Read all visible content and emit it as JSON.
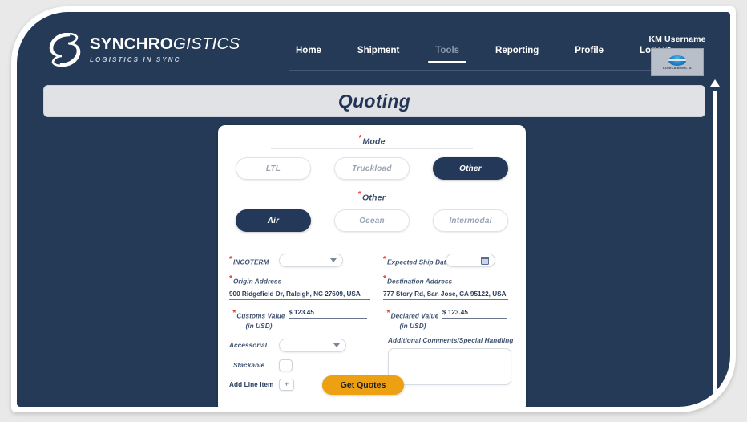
{
  "brand": {
    "name_strong": "SYNCHRO",
    "name_light": "GISTICS",
    "tagline": "LOGISTICS IN SYNC",
    "logo_icon": "synchrogistics-s-logo"
  },
  "nav": {
    "items": [
      {
        "label": "Home",
        "active": false
      },
      {
        "label": "Shipment",
        "active": false
      },
      {
        "label": "Tools",
        "active": true
      },
      {
        "label": "Reporting",
        "active": false
      },
      {
        "label": "Profile",
        "active": false
      },
      {
        "label": "Logout",
        "active": false
      }
    ]
  },
  "user": {
    "name": "KM Username",
    "logo_text": "KONICA MINOLTA",
    "logo_icon": "konica-minolta-logo"
  },
  "page": {
    "title": "Quoting"
  },
  "scrollbar": {
    "up_arrow_icon": "triangle-up-icon"
  },
  "form": {
    "mode": {
      "label": "Mode",
      "required": true,
      "options": [
        {
          "label": "LTL",
          "selected": false
        },
        {
          "label": "Truckload",
          "selected": false
        },
        {
          "label": "Other",
          "selected": true
        }
      ]
    },
    "other": {
      "label": "Other",
      "required": true,
      "options": [
        {
          "label": "Air",
          "selected": true
        },
        {
          "label": "Ocean",
          "selected": false
        },
        {
          "label": "Intermodal",
          "selected": false
        }
      ]
    },
    "incoterm": {
      "label": "INCOTERM",
      "required": true,
      "value": "",
      "icon": "chevron-down-icon"
    },
    "expected_ship_date": {
      "label": "Expected Ship Date",
      "required": true,
      "value": "",
      "icon": "calendar-icon"
    },
    "origin_address": {
      "label": "Origin Address",
      "required": true,
      "value": "900 Ridgefield Dr, Raleigh, NC 27609, USA"
    },
    "destination_address": {
      "label": "Destination Address",
      "required": true,
      "value": "777 Story Rd, San Jose, CA 95122, USA"
    },
    "customs_value": {
      "label_line1": "Customs Value",
      "label_line2": "(in USD)",
      "required": true,
      "value": "$ 123.45"
    },
    "declared_value": {
      "label_line1": "Declared Value",
      "label_line2": "(in USD)",
      "required": true,
      "value": "$ 123.45"
    },
    "accessorial": {
      "label": "Accessorial",
      "required": false,
      "value": "",
      "icon": "chevron-down-icon"
    },
    "stackable": {
      "label": "Stackable",
      "checked": false
    },
    "add_line_item": {
      "label": "Add Line Item",
      "button_glyph": "+"
    },
    "comments": {
      "label": "Additional Comments/Special Handling",
      "value": ""
    },
    "submit": {
      "label": "Get Quotes"
    }
  },
  "colors": {
    "panel_navy": "#253A57",
    "pill_selected": "#24395a",
    "accent_orange": "#eda012",
    "required_red": "#e8392c",
    "title_bar": "#e0e2e6"
  }
}
